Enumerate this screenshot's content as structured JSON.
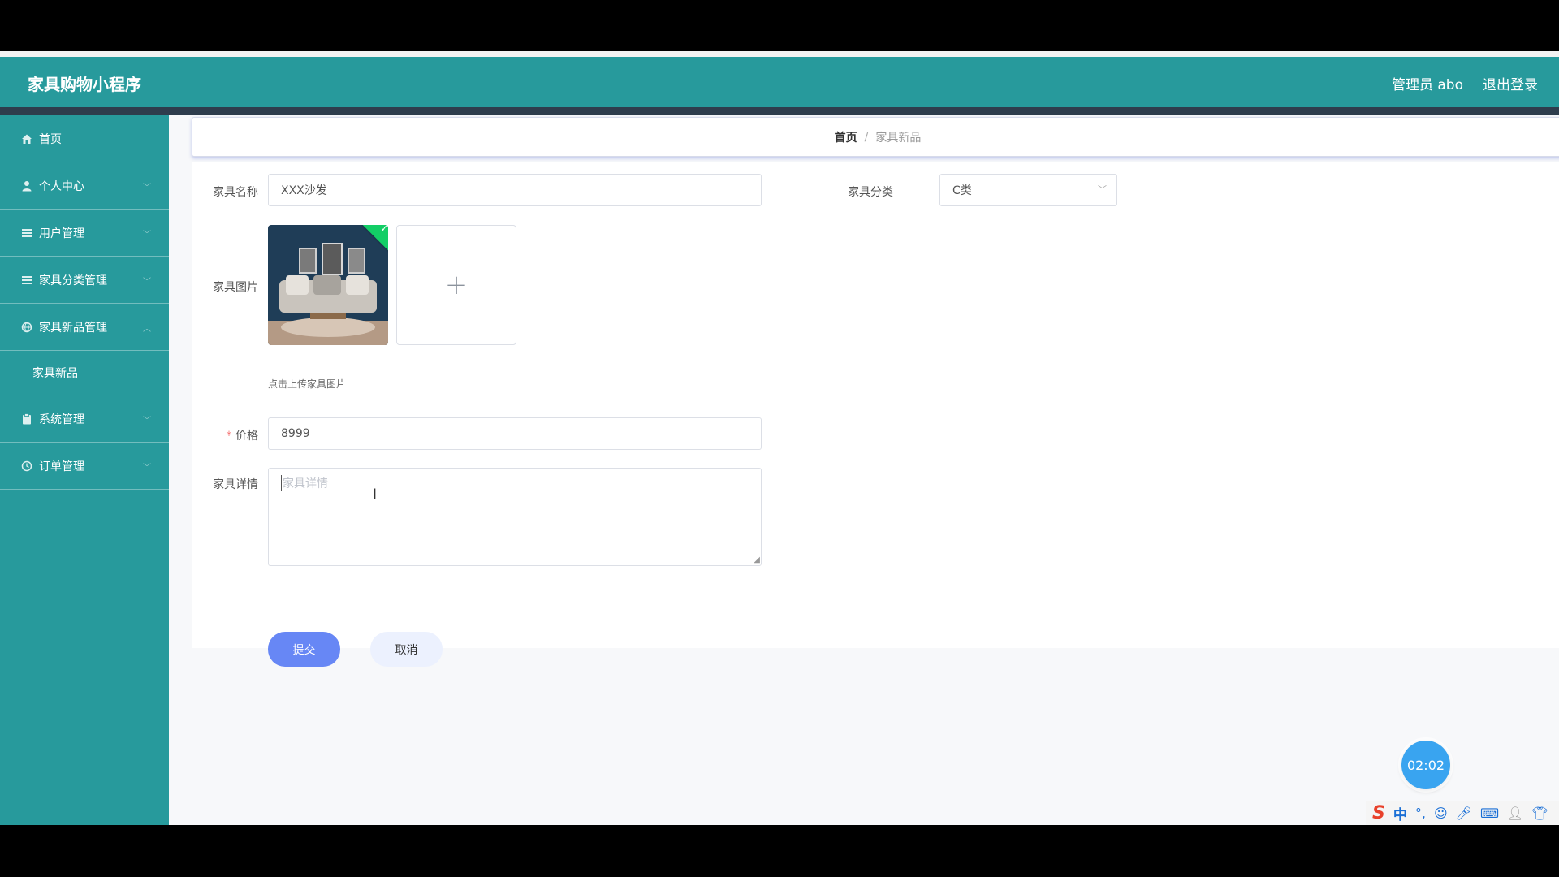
{
  "app": {
    "title": "家具购物小程序"
  },
  "header": {
    "user_label": "管理员 abo",
    "logout_label": "退出登录"
  },
  "sidebar": {
    "items": [
      {
        "label": "首页",
        "icon": "home-icon"
      },
      {
        "label": "个人中心",
        "icon": "user-icon"
      },
      {
        "label": "用户管理",
        "icon": "menu-icon"
      },
      {
        "label": "家具分类管理",
        "icon": "menu-icon"
      },
      {
        "label": "家具新品管理",
        "icon": "globe-icon",
        "expanded": true,
        "children": [
          "家具新品"
        ]
      },
      {
        "label": "系统管理",
        "icon": "clipboard-icon"
      },
      {
        "label": "订单管理",
        "icon": "clock-icon"
      }
    ]
  },
  "breadcrumb": {
    "home": "首页",
    "separator": "/",
    "current": "家具新品"
  },
  "form": {
    "name_label": "家具名称",
    "name_value": "XXX沙发",
    "category_label": "家具分类",
    "category_value": "C类",
    "image_label": "家具图片",
    "upload_tip": "点击上传家具图片",
    "price_required": "*",
    "price_label": "价格",
    "price_value": "8999",
    "detail_label": "家具详情",
    "detail_placeholder": "家具详情",
    "submit_label": "提交",
    "cancel_label": "取消"
  },
  "overlay": {
    "timer": "02:02",
    "ime_mode": "中"
  },
  "colors": {
    "header": "#279a9c",
    "submit": "#6787f5",
    "success": "#13ce66"
  }
}
